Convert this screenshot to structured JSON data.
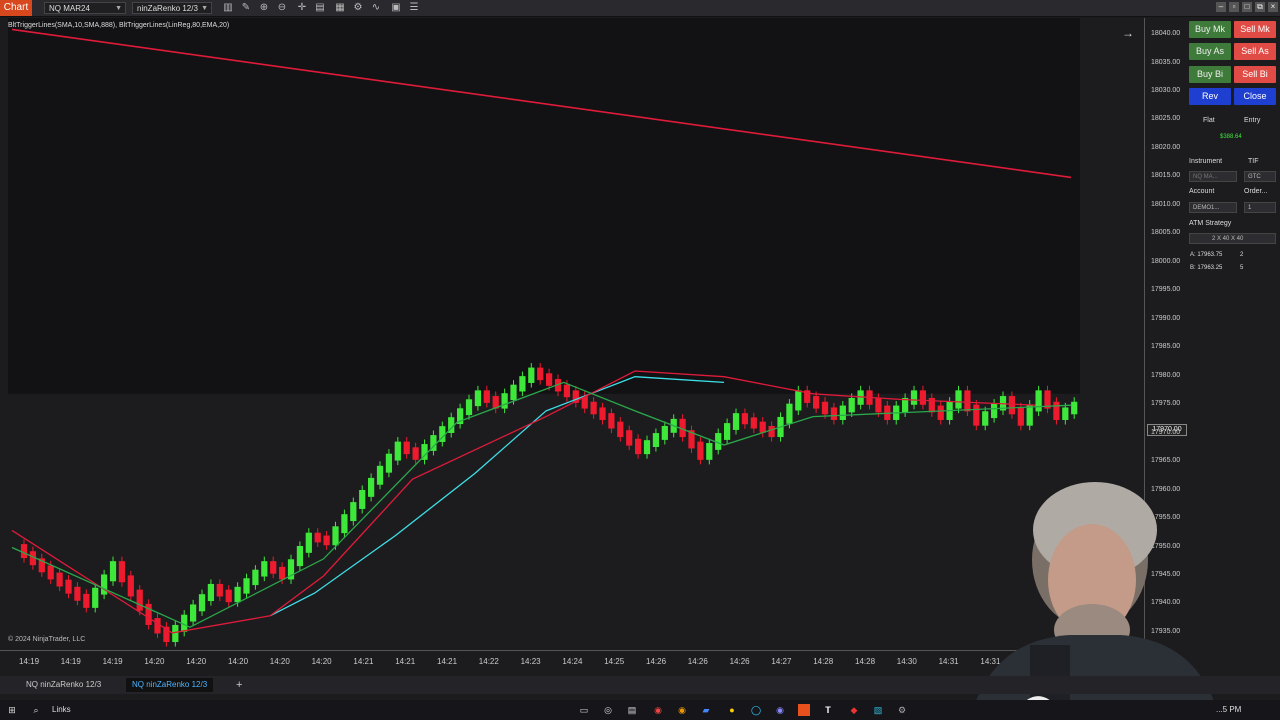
{
  "toolbar": {
    "chart_label": "Chart",
    "instrument": "NQ MAR24",
    "bar_type": "ninZaRenko 12/3",
    "icons": [
      "bars-icon",
      "pencil-icon",
      "zoom-in-icon",
      "zoom-out-icon",
      "crosshair-icon",
      "template-icon",
      "properties-icon",
      "strategy-icon",
      "indicator-icon",
      "list-icon"
    ]
  },
  "indicators_label": "BltTriggerLines(SMA,10,SMA,888), BltTriggerLines(LinReg,80,EMA,20)",
  "chart_data": {
    "type": "candlestick",
    "instrument": "NQ MAR24",
    "bar_type": "ninZaRenko 12/3",
    "last_price": "17970.00",
    "y_ticks": [
      "18040.00",
      "18035.00",
      "18030.00",
      "18025.00",
      "18020.00",
      "18015.00",
      "18010.00",
      "18005.00",
      "18000.00",
      "17995.00",
      "17990.00",
      "17985.00",
      "17980.00",
      "17975.00",
      "17970.00",
      "17965.00",
      "17960.00",
      "17955.00",
      "17950.00",
      "17945.00",
      "17940.00",
      "17935.00"
    ],
    "x_ticks": [
      "14:19",
      "14:19",
      "14:19",
      "14:20",
      "14:20",
      "14:20",
      "14:20",
      "14:20",
      "14:21",
      "14:21",
      "14:21",
      "14:22",
      "14:23",
      "14:24",
      "14:25",
      "14:26",
      "14:26",
      "14:26",
      "14:27",
      "14:28",
      "14:28",
      "14:30",
      "14:31",
      "14:31"
    ],
    "ylim": [
      17932,
      18043
    ],
    "close_path": [
      [
        0,
        17950
      ],
      [
        8,
        17940
      ],
      [
        11,
        17947
      ],
      [
        15,
        17937
      ],
      [
        17,
        17934
      ],
      [
        22,
        17943
      ],
      [
        24,
        17941
      ],
      [
        28,
        17947
      ],
      [
        30,
        17945
      ],
      [
        33,
        17952
      ],
      [
        35,
        17951
      ],
      [
        43,
        17968
      ],
      [
        45,
        17966
      ],
      [
        52,
        17977
      ],
      [
        54,
        17975
      ],
      [
        58,
        17981
      ],
      [
        66,
        17973
      ],
      [
        70,
        17967
      ],
      [
        74,
        17972
      ],
      [
        77,
        17966
      ],
      [
        81,
        17973
      ],
      [
        85,
        17970
      ],
      [
        88,
        17977
      ],
      [
        92,
        17973
      ],
      [
        95,
        17977
      ],
      [
        98,
        17973
      ],
      [
        101,
        17977
      ],
      [
        104,
        17973
      ],
      [
        106,
        17977
      ],
      [
        108,
        17972
      ],
      [
        111,
        17976
      ],
      [
        113,
        17972
      ],
      [
        115,
        17977
      ],
      [
        117,
        17973
      ],
      [
        119,
        17975
      ]
    ],
    "series": [
      {
        "name": "",
        "color": "#e01b3a",
        "points": [
          [
            0,
            18041
          ],
          [
            119,
            18015
          ]
        ]
      },
      {
        "name": "",
        "color": "#3ee0e8",
        "points": [
          [
            29,
            17938
          ],
          [
            34,
            17942
          ],
          [
            43,
            17952
          ],
          [
            52,
            17963
          ],
          [
            60,
            17974
          ],
          [
            70,
            17980
          ],
          [
            80,
            17979
          ]
        ]
      },
      {
        "name": "",
        "color": "#e01b3a",
        "points": [
          [
            0,
            17953
          ],
          [
            18,
            17935
          ],
          [
            29,
            17938
          ],
          [
            35,
            17945
          ],
          [
            45,
            17962
          ],
          [
            60,
            17973
          ],
          [
            70,
            17981
          ],
          [
            80,
            17980
          ],
          [
            90,
            17977
          ],
          [
            100,
            17976
          ],
          [
            115,
            17975
          ]
        ]
      },
      {
        "name": "",
        "color": "#2aa84a",
        "points": [
          [
            0,
            17950
          ],
          [
            20,
            17936
          ],
          [
            35,
            17948
          ],
          [
            50,
            17972
          ],
          [
            62,
            17979
          ],
          [
            70,
            17974
          ],
          [
            80,
            17968
          ],
          [
            90,
            17973
          ],
          [
            119,
            17975
          ]
        ]
      }
    ],
    "grid": false
  },
  "copyright": "© 2024 NinjaTrader, LLC",
  "order_panel": {
    "buy_mkt": "Buy Mk",
    "sell_mkt": "Sell Mk",
    "buy_ask": "Buy As",
    "sell_ask": "Sell As",
    "buy_bid": "Buy Bi",
    "sell_bid": "Sell Bi",
    "rev": "Rev",
    "close": "Close",
    "flat": "Flat",
    "entry": "Entry",
    "pnl": "$388.64",
    "instrument_label": "Instrument",
    "tif_label": "TIF",
    "instrument_value": "NQ MA...",
    "tif_value": "GTC",
    "account_label": "Account",
    "order_label": "Order...",
    "account_value": "DEMO1...",
    "order_qty": "1",
    "atm_label": "ATM Strategy",
    "atm_value": "2 X 40 X 40",
    "ask": "A: 17963.75",
    "ask_size": "2",
    "bid": "B: 17963.25",
    "bid_size": "5"
  },
  "tabs": [
    {
      "label": "NQ ninZaRenko 12/3",
      "active": false
    },
    {
      "label": "NQ ninZaRenko 12/3",
      "active": true
    }
  ],
  "taskbar": {
    "links_label": "Links",
    "clock": "...5 PM"
  },
  "colors": {
    "up_candle": "#3ee83a",
    "down_candle": "#ee1a2e",
    "background": "#1c1c1f",
    "price_band": "#121214"
  }
}
